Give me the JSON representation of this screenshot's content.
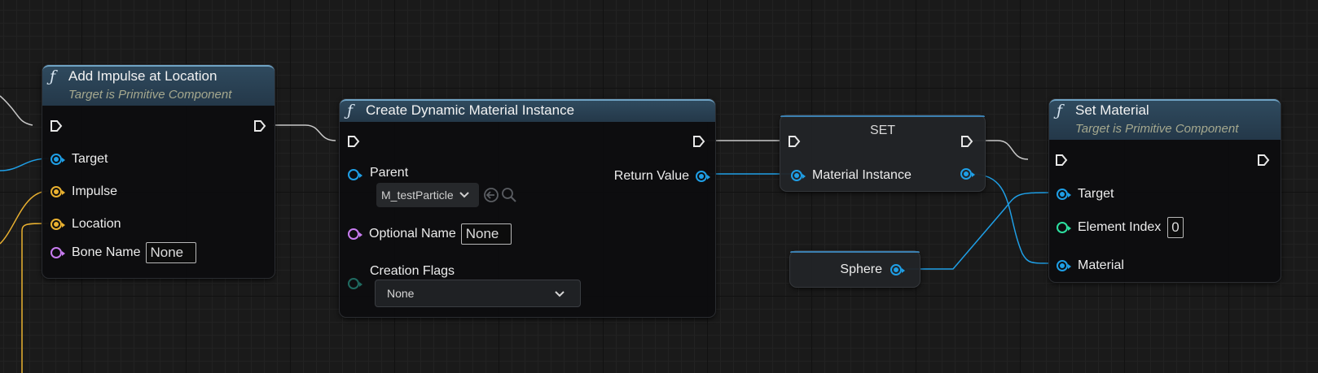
{
  "nodes": {
    "add_impulse": {
      "title": "Add Impulse at Location",
      "subtitle": "Target is Primitive Component",
      "pins": {
        "target": "Target",
        "impulse": "Impulse",
        "location": "Location",
        "bone_name": "Bone Name"
      },
      "bone_name_value": "None"
    },
    "create_dmi": {
      "title": "Create Dynamic Material Instance",
      "pins": {
        "parent": "Parent",
        "return_value": "Return Value",
        "optional_name": "Optional Name",
        "creation_flags": "Creation Flags"
      },
      "parent_asset": "M_testParticle",
      "optional_name_value": "None",
      "creation_flags_value": "None"
    },
    "set_var": {
      "title": "SET",
      "pins": {
        "material_instance": "Material Instance"
      }
    },
    "sphere": {
      "label": "Sphere"
    },
    "set_material": {
      "title": "Set Material",
      "subtitle": "Target is Primitive Component",
      "pins": {
        "target": "Target",
        "element_index": "Element Index",
        "material": "Material"
      },
      "element_index_value": "0"
    }
  },
  "colors": {
    "exec_wire": "#c8c8c8",
    "object_pin": "#1f9fe6",
    "vector_pin": "#eab130",
    "name_pin": "#c87cf0",
    "int_pin": "#2de0a0",
    "function_header": "#2f4a5e"
  },
  "icons": {
    "function": "function-f-icon",
    "exec": "exec-pin-icon",
    "browse": "use-selected-arrow-icon",
    "search": "magnifier-icon",
    "dropdown": "chevron-down-icon"
  }
}
